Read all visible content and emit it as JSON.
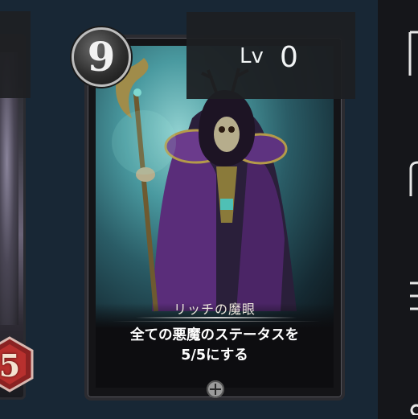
{
  "left_card": {
    "cost": "5"
  },
  "card": {
    "cost": "9",
    "name": "リッチの魔眼",
    "text_line1": "全ての悪魔のステータスを",
    "text_line2": "5/5にする"
  },
  "level": {
    "label": "Lv",
    "value": "0"
  },
  "colors": {
    "background": "#182735",
    "right_panel": "#15161a",
    "card_frame": "#2b2b30"
  }
}
